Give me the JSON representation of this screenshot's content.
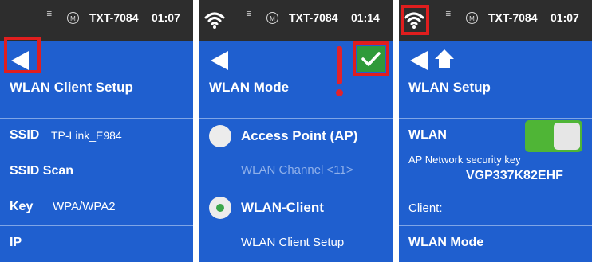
{
  "colors": {
    "screen_bg": "#1f5fcf",
    "statusbar_bg": "#2d2d2d",
    "highlight": "#e01e1e",
    "toggle_on": "#4fb536",
    "confirm": "#2f9a3a"
  },
  "statusbar": {
    "signal_label": "≣",
    "mode_badge": "M",
    "device_name": "TXT-7084"
  },
  "screen1": {
    "time": "01:07",
    "title": "WLAN Client Setup",
    "rows": [
      {
        "label": "SSID",
        "value": "TP-Link_E984"
      },
      {
        "label": "SSID Scan",
        "value": ""
      },
      {
        "label": "Key",
        "value": "WPA/WPA2"
      },
      {
        "label": "IP",
        "value": ""
      }
    ]
  },
  "screen2": {
    "time": "01:14",
    "title": "WLAN Mode",
    "options": [
      {
        "label": "Access Point (AP)",
        "selected": false,
        "sub": "WLAN Channel <11>"
      },
      {
        "label": "WLAN-Client",
        "selected": true,
        "sub": "WLAN Client Setup"
      }
    ]
  },
  "screen3": {
    "time": "01:07",
    "title": "WLAN Setup",
    "wlan_label": "WLAN",
    "wlan_enabled": true,
    "ap_key_label": "AP Network security key",
    "ap_key_value": "VGP337K82EHF",
    "client_label": "Client:",
    "mode_label": "WLAN Mode"
  },
  "icons": [
    "wifi-icon",
    "signal-icon",
    "mode-badge-icon",
    "back-arrow-icon",
    "home-icon",
    "checkmark-icon",
    "exclamation-icon"
  ]
}
